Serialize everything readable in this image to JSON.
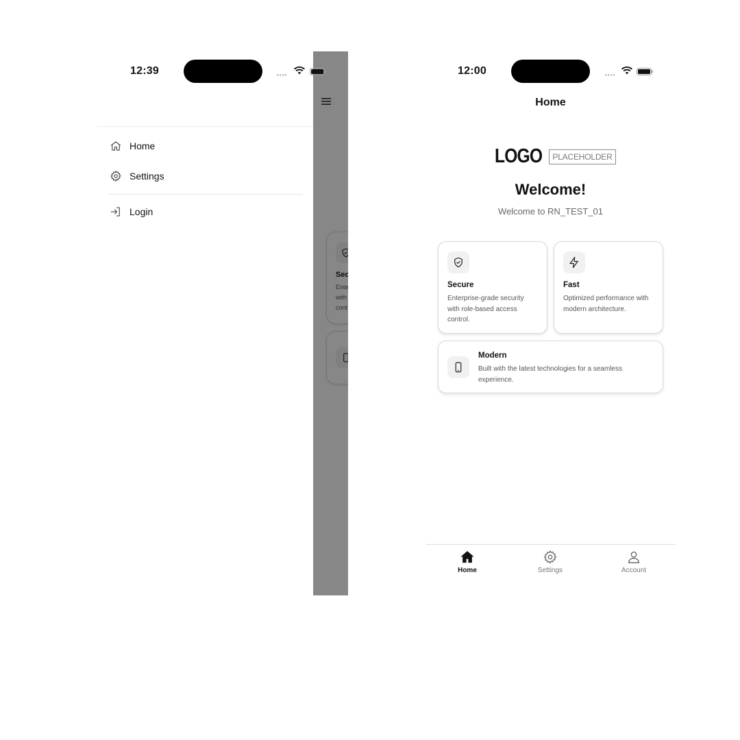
{
  "left_phone": {
    "status": {
      "time": "12:39"
    },
    "drawer": {
      "items": [
        {
          "label": "Home",
          "icon": "home-outline-icon"
        },
        {
          "label": "Settings",
          "icon": "gear-icon"
        }
      ],
      "auth_item": {
        "label": "Login",
        "icon": "login-icon"
      }
    },
    "peek": {
      "menu_icon": "hamburger-menu-icon",
      "card_title": "Sec",
      "card_lines": [
        "Ente",
        "with",
        "cont"
      ]
    },
    "overlay_color": "#000000"
  },
  "right_phone": {
    "status": {
      "time": "12:00"
    },
    "header": {
      "title": "Home"
    },
    "logo": {
      "main": "LOGO",
      "sub": "PLACEHOLDER"
    },
    "welcome": {
      "title": "Welcome!",
      "subtitle": "Welcome to RN_TEST_01"
    },
    "features": {
      "secure": {
        "icon": "shield-check-icon",
        "title": "Secure",
        "description": "Enterprise-grade security with role-based access control."
      },
      "fast": {
        "icon": "lightning-icon",
        "title": "Fast",
        "description": "Optimized performance with modern architecture."
      },
      "modern": {
        "icon": "smartphone-icon",
        "title": "Modern",
        "description": "Built with the latest technologies for a seamless experience."
      }
    },
    "tabs": [
      {
        "label": "Home",
        "icon": "home-filled-icon",
        "active": true
      },
      {
        "label": "Settings",
        "icon": "gear-icon",
        "active": false
      },
      {
        "label": "Account",
        "icon": "person-icon",
        "active": false
      }
    ]
  },
  "colors": {
    "text_primary": "#111111",
    "text_secondary": "#666666",
    "card_border": "#d9d9d9",
    "icon_tile": "#f1f1f1"
  }
}
